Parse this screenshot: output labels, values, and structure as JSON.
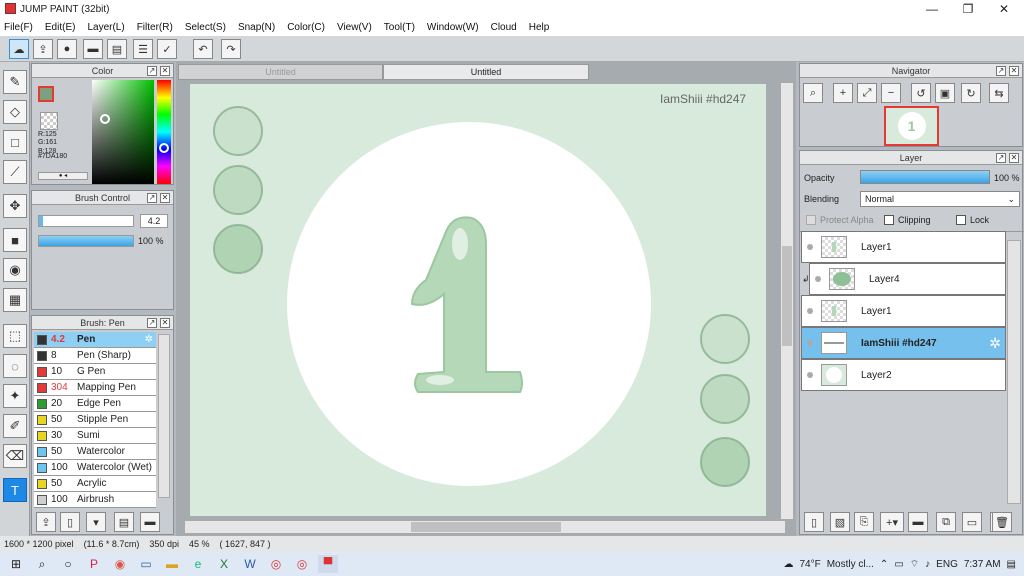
{
  "window": {
    "title": "JUMP PAINT (32bit)",
    "minimize": "—",
    "restore": "❐",
    "close": "✕"
  },
  "menu": [
    "File(F)",
    "Edit(E)",
    "Layer(L)",
    "Filter(R)",
    "Select(S)",
    "Snap(N)",
    "Color(C)",
    "View(V)",
    "Tool(T)",
    "Window(W)",
    "Cloud",
    "Help"
  ],
  "toolbar_icons": [
    "cloud-icon",
    "upload-icon",
    "comment-icon",
    "message-icon",
    "document-icon",
    "list-icon",
    "check-icon",
    "undo-icon",
    "redo-icon"
  ],
  "color_panel": {
    "title": "Color",
    "main_color": "#7DA180",
    "rgb": [
      "R:125",
      "G:161",
      "B:128"
    ],
    "hex": "#7DA180"
  },
  "brush_control": {
    "title": "Brush Control",
    "size": "4.2",
    "opacity": "100 %"
  },
  "brush_panel": {
    "title": "Brush: Pen",
    "brushes": [
      {
        "size": "4.2",
        "name": "Pen",
        "color": "#333333",
        "selected": true,
        "size_color": "#e53935"
      },
      {
        "size": "8",
        "name": "Pen (Sharp)",
        "color": "#333333"
      },
      {
        "size": "10",
        "name": "G Pen",
        "color": "#e53935"
      },
      {
        "size": "304",
        "name": "Mapping Pen",
        "color": "#e53935",
        "size_color": "#e53935"
      },
      {
        "size": "20",
        "name": "Edge Pen",
        "color": "#2e9e2e"
      },
      {
        "size": "50",
        "name": "Stipple Pen",
        "color": "#e8d422"
      },
      {
        "size": "30",
        "name": "Sumi",
        "color": "#e8d422"
      },
      {
        "size": "50",
        "name": "Watercolor",
        "color": "#6ec6f0"
      },
      {
        "size": "100",
        "name": "Watercolor (Wet)",
        "color": "#6ec6f0"
      },
      {
        "size": "50",
        "name": "Acrylic",
        "color": "#e8d422"
      },
      {
        "size": "100",
        "name": "Airbrush",
        "color": "#cfcfcf"
      }
    ]
  },
  "tabs": [
    "Untitled",
    "Untitled"
  ],
  "canvas": {
    "watermark": "IamShiii #hd247",
    "big_digit": "1",
    "bg_color": "#d8eadb"
  },
  "navigator": {
    "title": "Navigator"
  },
  "layer_panel": {
    "title": "Layer",
    "opacity_label": "Opacity",
    "opacity_value": "100 %",
    "opacity": 100,
    "blending_label": "Blending",
    "blending_value": "Normal",
    "protect_alpha": "Protect Alpha",
    "clipping": "Clipping",
    "lock": "Lock",
    "layers": [
      {
        "name": "Layer1"
      },
      {
        "name": "Layer4"
      },
      {
        "name": "Layer1"
      },
      {
        "name": "IamShiii #hd247",
        "selected": true
      },
      {
        "name": "Layer2"
      }
    ]
  },
  "status": {
    "dims": "1600 * 1200 pixel",
    "size_cm": "(11.6 * 8.7cm)",
    "dpi": "350 dpi",
    "zoom": "45 %",
    "coords": "( 1627, 847 )"
  },
  "taskbar": {
    "weather": "74°F",
    "weather_text": "Mostly cl...",
    "lang": "ENG",
    "time": "7:37 AM"
  }
}
